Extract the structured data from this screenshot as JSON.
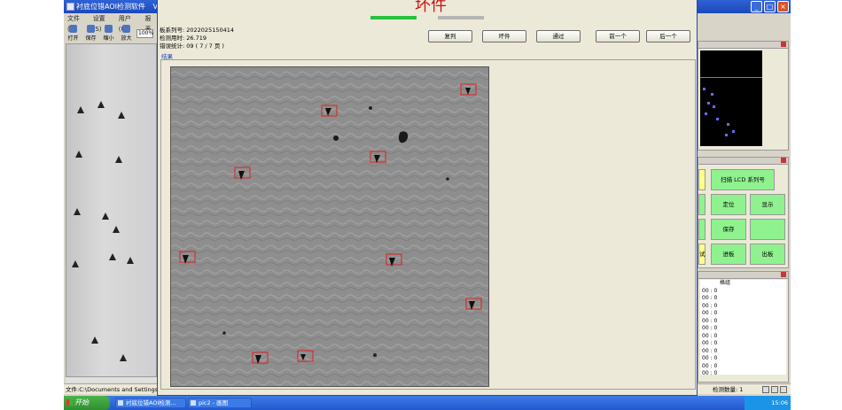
{
  "app": {
    "title": "衬底位错AOI检测软件",
    "title_suffix": "Ver",
    "menu": [
      "文件(F)",
      "设置(S)",
      "用户(U)",
      "报表"
    ],
    "toolbar": [
      "打开",
      "保存",
      "缩小",
      "放大"
    ],
    "zoom": "100%"
  },
  "dialog": {
    "status": "坏件",
    "serial": "板系列号: 2022025150414",
    "time": "检测用时: 26.719",
    "errors": "错误统计: 09 ( 7 / 7 页 )",
    "buttons": {
      "recheck": "复判",
      "bad": "坏件",
      "pass": "通过",
      "prev": "前一个",
      "next": "后一个"
    },
    "result_label": "结果"
  },
  "panel_buttons": {
    "scan": "扫描 LCD 系列号",
    "locate": "定位",
    "display": "显示",
    "save": "保存",
    "board_in": "进板",
    "board_out": "出板",
    "test": "试"
  },
  "list": {
    "header": "格组",
    "rows": [
      "00 : 0",
      "00 : 0",
      "00 : 0",
      "00 : 0",
      "00 : 0",
      "00 : 0",
      "00 : 0",
      "00 : 0",
      "00 : 0",
      "00 : 0",
      "00 : 0",
      "00 : 0"
    ]
  },
  "statusbar": {
    "path": "文件:C:\\Documents and Settings\\",
    "count": "检测数量: 1"
  },
  "taskbar": {
    "start": "开始",
    "tasks": [
      "衬底位错AOI检测...",
      "pic2 - 画图"
    ],
    "clock": "15:06"
  }
}
